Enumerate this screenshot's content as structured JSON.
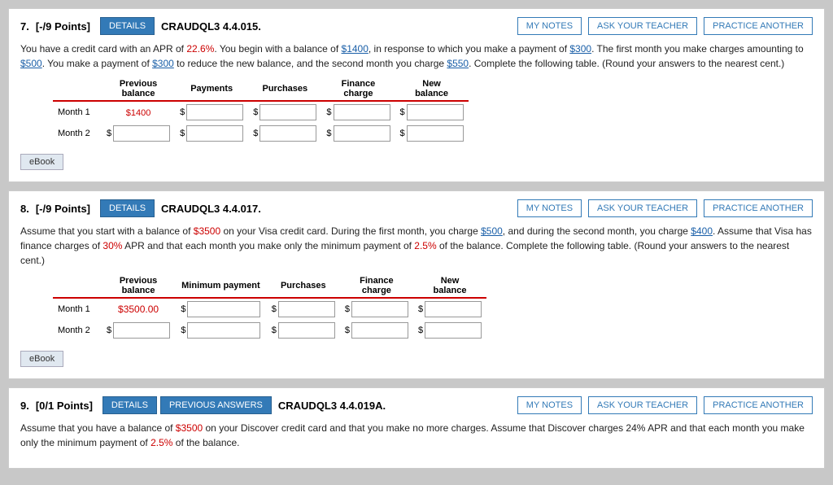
{
  "questions": [
    {
      "id": "q7",
      "number": "7.",
      "points": "[-/9 Points]",
      "details_label": "DETAILS",
      "code": "CRAUDQL3 4.4.015.",
      "my_notes_label": "MY NOTES",
      "ask_teacher_label": "ASK YOUR TEACHER",
      "practice_label": "PRACTICE ANOTHER",
      "text_parts": [
        {
          "text": "You have a credit card with an APR of ",
          "type": "normal"
        },
        {
          "text": "22.6%",
          "type": "red"
        },
        {
          "text": ". You begin with a balance of ",
          "type": "normal"
        },
        {
          "text": "$1400",
          "type": "blue"
        },
        {
          "text": ", in response to which you make a payment of ",
          "type": "normal"
        },
        {
          "text": "$300",
          "type": "blue"
        },
        {
          "text": ". The first month you make charges amounting to ",
          "type": "normal"
        },
        {
          "text": "$500",
          "type": "blue"
        },
        {
          "text": ". You make a payment of ",
          "type": "normal"
        },
        {
          "text": "$300",
          "type": "blue"
        },
        {
          "text": " to reduce the new balance, and the second month you charge ",
          "type": "normal"
        },
        {
          "text": "$550",
          "type": "blue"
        },
        {
          "text": ". Complete the following table. (Round your answers to the nearest cent.)",
          "type": "normal"
        }
      ],
      "table": {
        "headers": [
          "Previous\nbalance",
          "Payments",
          "Purchases",
          "Finance\ncharge",
          "New\nbalance"
        ],
        "rows": [
          {
            "label": "Month 1",
            "prev_value": "$1400",
            "prev_input": false,
            "pay_input": true,
            "pur_input": true,
            "fin_input": true,
            "new_input": true
          },
          {
            "label": "Month 2",
            "prev_value": null,
            "prev_input": true,
            "pay_input": true,
            "pur_input": true,
            "fin_input": true,
            "new_input": true
          }
        ]
      },
      "ebook_label": "eBook"
    },
    {
      "id": "q8",
      "number": "8.",
      "points": "[-/9 Points]",
      "details_label": "DETAILS",
      "code": "CRAUDQL3 4.4.017.",
      "my_notes_label": "MY NOTES",
      "ask_teacher_label": "ASK YOUR TEACHER",
      "practice_label": "PRACTICE ANOTHER",
      "text_parts": [
        {
          "text": "Assume that you start with a balance of ",
          "type": "normal"
        },
        {
          "text": "$3500",
          "type": "red"
        },
        {
          "text": " on your Visa credit card. During the first month, you charge ",
          "type": "normal"
        },
        {
          "text": "$500",
          "type": "blue"
        },
        {
          "text": ", and during the second month, you charge ",
          "type": "normal"
        },
        {
          "text": "$400",
          "type": "blue"
        },
        {
          "text": ". Assume that Visa has finance charges of ",
          "type": "normal"
        },
        {
          "text": "30%",
          "type": "red"
        },
        {
          "text": " APR and that each month you make only the minimum payment of ",
          "type": "normal"
        },
        {
          "text": "2.5%",
          "type": "red"
        },
        {
          "text": " of the balance. Complete the following table. (Round your answers to the nearest cent.)",
          "type": "normal"
        }
      ],
      "table": {
        "headers": [
          "Previous\nbalance",
          "Minimum payment",
          "Purchases",
          "Finance\ncharge",
          "New\nbalance"
        ],
        "rows": [
          {
            "label": "Month 1",
            "prev_value": "$3500.00",
            "prev_input": false,
            "pay_input": true,
            "pur_input": true,
            "fin_input": true,
            "new_input": true
          },
          {
            "label": "Month 2",
            "prev_value": null,
            "prev_input": true,
            "pay_input": true,
            "pur_input": true,
            "fin_input": true,
            "new_input": true
          }
        ]
      },
      "ebook_label": "eBook"
    },
    {
      "id": "q9",
      "number": "9.",
      "points": "[0/1 Points]",
      "details_label": "DETAILS",
      "prev_answers_label": "PREVIOUS ANSWERS",
      "code": "CRAUDQL3 4.4.019A.",
      "my_notes_label": "MY NOTES",
      "ask_teacher_label": "ASK YOUR TEACHER",
      "practice_label": "PRACTICE ANOTHER",
      "text_parts": [
        {
          "text": "Assume that you have a balance of ",
          "type": "normal"
        },
        {
          "text": "$3500",
          "type": "red"
        },
        {
          "text": " on your Discover credit card and that you make no more charges. Assume that Discover charges 24% APR and that each month you make only the minimum payment of ",
          "type": "normal"
        },
        {
          "text": "2.5%",
          "type": "red"
        },
        {
          "text": " of the balance.",
          "type": "normal"
        }
      ]
    }
  ]
}
